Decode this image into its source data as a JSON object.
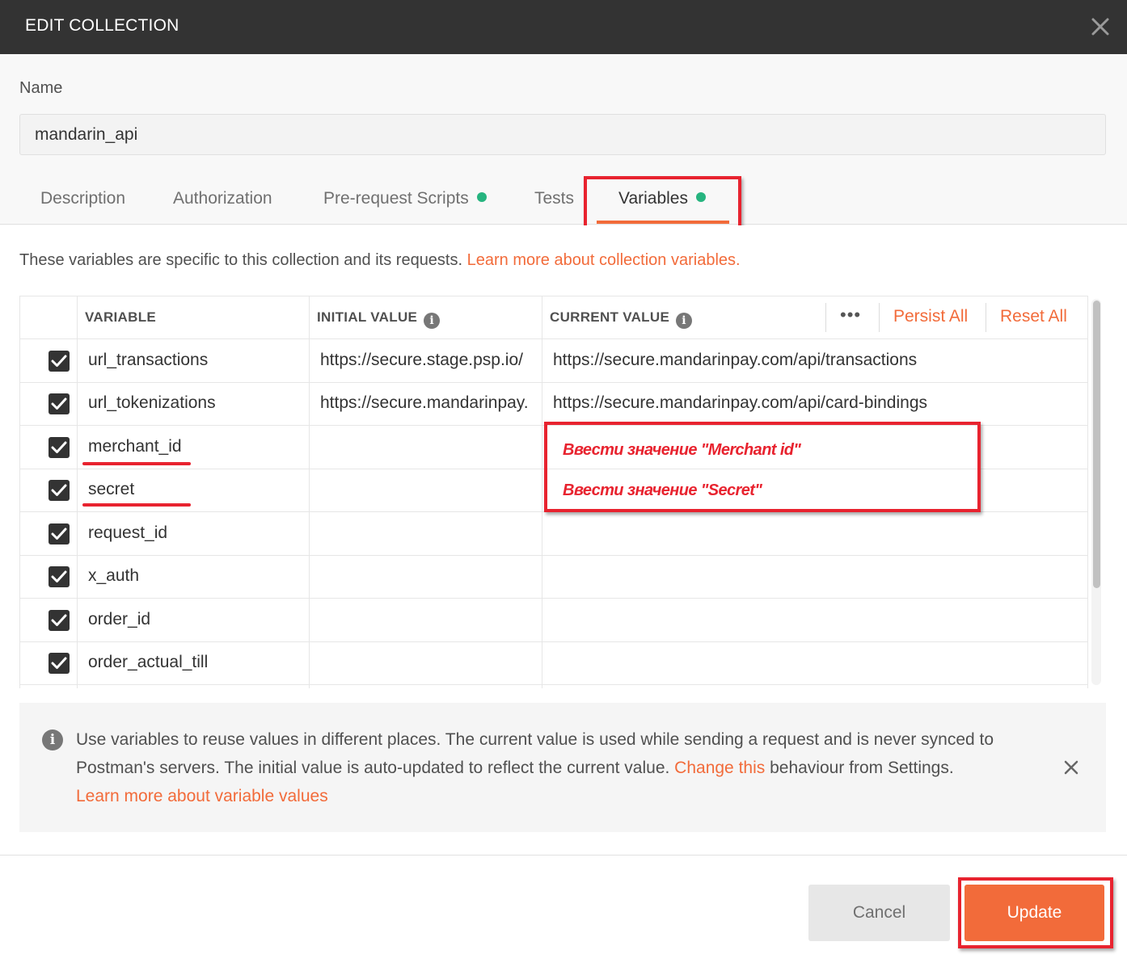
{
  "dialog": {
    "title": "EDIT COLLECTION",
    "close_icon": "close-icon"
  },
  "name_field": {
    "label": "Name",
    "value": "mandarin_api"
  },
  "tabs": [
    {
      "label": "Description",
      "active": false,
      "dot": false
    },
    {
      "label": "Authorization",
      "active": false,
      "dot": false
    },
    {
      "label": "Pre-request Scripts",
      "active": false,
      "dot": true
    },
    {
      "label": "Tests",
      "active": false,
      "dot": false
    },
    {
      "label": "Variables",
      "active": true,
      "dot": true
    }
  ],
  "intro": {
    "text": "These variables are specific to this collection and its requests. ",
    "link": "Learn more about collection variables."
  },
  "table": {
    "headers": {
      "variable": "VARIABLE",
      "initial": "INITIAL VALUE",
      "current": "CURRENT VALUE"
    },
    "more_icon": "•••",
    "persist_all": "Persist All",
    "reset_all": "Reset All",
    "rows": [
      {
        "checked": true,
        "variable": "url_transactions",
        "initial": "https://secure.stage.psp.io/",
        "current": "https://secure.mandarinpay.com/api/transactions"
      },
      {
        "checked": true,
        "variable": "url_tokenizations",
        "initial": "https://secure.mandarinpay.",
        "current": "https://secure.mandarinpay.com/api/card-bindings"
      },
      {
        "checked": true,
        "variable": "merchant_id",
        "initial": "",
        "current": ""
      },
      {
        "checked": true,
        "variable": "secret",
        "initial": "",
        "current": ""
      },
      {
        "checked": true,
        "variable": "request_id",
        "initial": "",
        "current": ""
      },
      {
        "checked": true,
        "variable": "x_auth",
        "initial": "",
        "current": ""
      },
      {
        "checked": true,
        "variable": "order_id",
        "initial": "",
        "current": ""
      },
      {
        "checked": true,
        "variable": "order_actual_till",
        "initial": "",
        "current": ""
      }
    ]
  },
  "annotations": {
    "merchant_id_hint": "Ввести значение \"Merchant id\"",
    "secret_hint": "Ввести значение \"Secret\"",
    "color": "#e8232f"
  },
  "info": {
    "text_1": "Use variables to reuse values in different places. The current value is used while sending a request and is never synced to Postman's servers. The initial value is auto-updated to reflect the current value. ",
    "link_1": "Change this",
    "text_2": " behaviour from Settings.",
    "link_2": "Learn more about variable values"
  },
  "footer": {
    "cancel": "Cancel",
    "update": "Update"
  },
  "colors": {
    "accent": "#f26b3a",
    "title_bar": "#333333",
    "tab_dot": "#26b47f"
  }
}
